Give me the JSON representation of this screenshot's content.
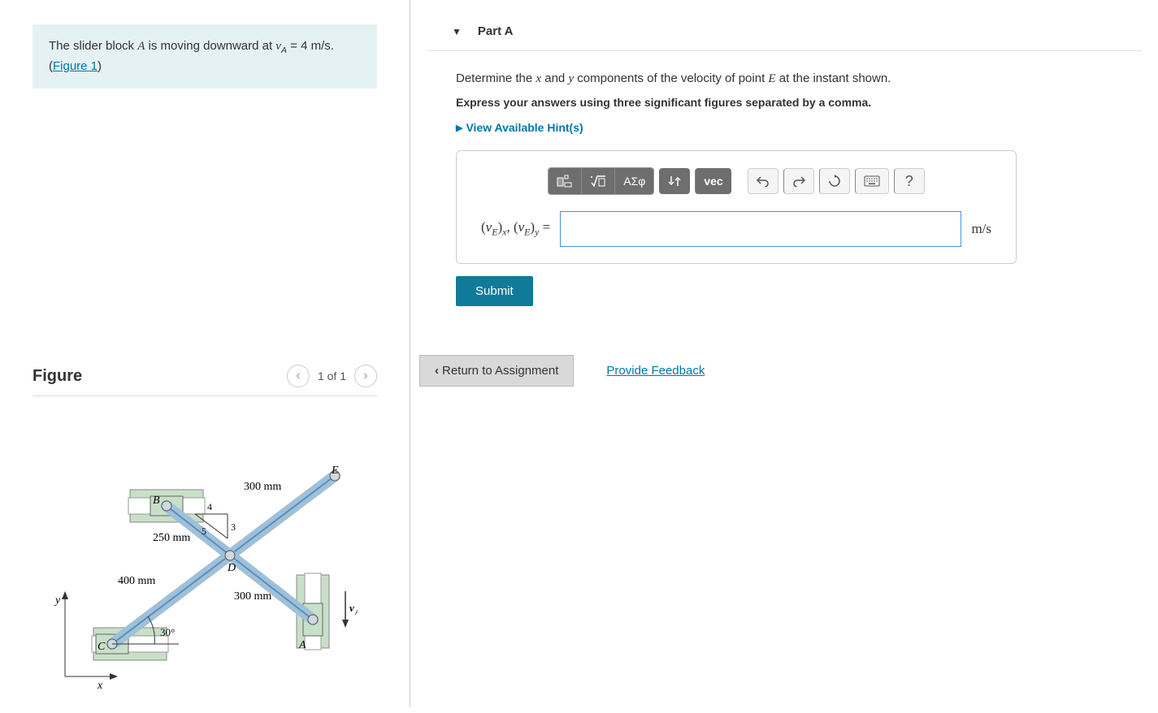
{
  "problem": {
    "text_prefix": "The slider block ",
    "var_A": "A",
    "text_mid": " is moving downward at ",
    "var_vA": "v",
    "var_vA_sub": "A",
    "text_eq": " = 4 m/s.",
    "figure_link": "Figure 1"
  },
  "figure": {
    "title": "Figure",
    "page": "1 of 1",
    "labels": {
      "B": "B",
      "E": "E",
      "D": "D",
      "C": "C",
      "A": "A",
      "len_300_1": "300 mm",
      "len_300_2": "300 mm",
      "len_250": "250 mm",
      "len_400": "400 mm",
      "angle_30": "30°",
      "ratio_3": "3",
      "ratio_4": "4",
      "ratio_5": "5",
      "vA_arrow": "v",
      "vA_arrow_sub": "A",
      "x_axis": "x",
      "y_axis": "y"
    }
  },
  "part": {
    "label": "Part A",
    "instruction_pre": "Determine the ",
    "var_x": "x",
    "instruction_and": " and ",
    "var_y": "y",
    "instruction_mid": " components of the velocity of point ",
    "var_E": "E",
    "instruction_post": " at the instant shown.",
    "format": "Express your answers using three significant figures separated by a comma.",
    "hints": "View Available Hint(s)",
    "answer_label": "(vE)x, (vE)y",
    "equals": " =",
    "unit": "m/s",
    "submit": "Submit"
  },
  "toolbar": {
    "templates": "templates",
    "sqrt": "sqrt",
    "greek": "ΑΣφ",
    "subscript": "↓↑",
    "vec": "vec",
    "undo": "↶",
    "redo": "↷",
    "reset": "↻",
    "keyboard": "⌨",
    "help": "?"
  },
  "footer": {
    "return": "Return to Assignment",
    "feedback": "Provide Feedback"
  }
}
